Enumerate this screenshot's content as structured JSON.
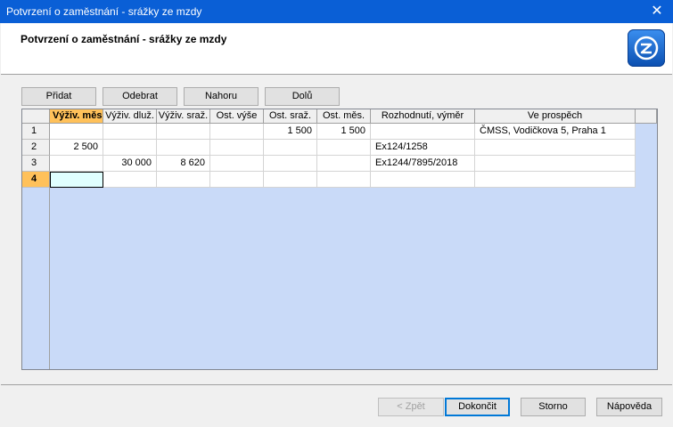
{
  "window": {
    "title": "Potvrzení o zaměstnání - srážky ze mzdy",
    "close_glyph": "✕"
  },
  "header": {
    "title": "Potvrzení o zaměstnání - srážky ze mzdy",
    "logo": "app-logo-icon"
  },
  "toolbar": {
    "add": "Přidat",
    "remove": "Odebrat",
    "up": "Nahoru",
    "down": "Dolů"
  },
  "grid": {
    "columns": [
      "Výživ. měs",
      "Výživ. dluž.",
      "Výživ. sraž.",
      "Ost. výše",
      "Ost. sraž.",
      "Ost. měs.",
      "Rozhodnutí, výměr",
      "Ve prospěch"
    ],
    "rows": [
      {
        "num": "1",
        "cells": [
          "",
          "",
          "",
          "",
          "1 500",
          "1 500",
          "",
          "ČMSS, Vodičkova 5, Praha 1"
        ]
      },
      {
        "num": "2",
        "cells": [
          "2 500",
          "",
          "",
          "",
          "",
          "",
          "Ex124/1258",
          ""
        ]
      },
      {
        "num": "3",
        "cells": [
          "",
          "30 000",
          "8 620",
          "",
          "",
          "",
          "Ex1244/7895/2018",
          ""
        ]
      },
      {
        "num": "4",
        "cells": [
          "",
          "",
          "",
          "",
          "",
          "",
          "",
          ""
        ]
      }
    ]
  },
  "footer": {
    "back": "< Zpět",
    "finish": "Dokončit",
    "cancel": "Storno",
    "help": "Nápověda"
  },
  "colors": {
    "titlebar": "#0a5fd6",
    "grid_bg": "#c9daf8",
    "active_header": "#ffc15a"
  }
}
